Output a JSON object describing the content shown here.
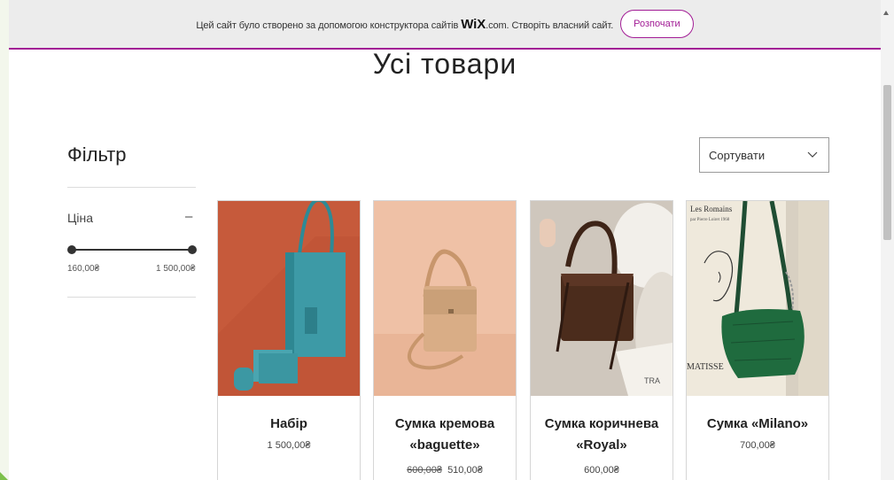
{
  "wix_banner": {
    "text_before": "Цей сайт було створено за допомогою конструктора сайтів ",
    "logo": "WiX",
    "text_after": ".com. Створіть власний сайт.",
    "button_label": "Розпочати"
  },
  "page": {
    "title": "Усі товари"
  },
  "filter": {
    "title": "Фільтр",
    "price_label": "Ціна",
    "toggle_symbol": "–",
    "min_price": "160,00₴",
    "max_price": "1 500,00₴"
  },
  "sort": {
    "label": "Сортувати",
    "icon": "chevron-down-icon"
  },
  "products": [
    {
      "name": "Набір",
      "price": "1 500,00₴"
    },
    {
      "name": "Сумка кремова «baguette»",
      "old_price": "600,00₴",
      "price": "510,00₴"
    },
    {
      "name": "Сумка коричнева «Royal»",
      "price": "600,00₴"
    },
    {
      "name": "Сумка «Milano»",
      "price": "700,00₴"
    }
  ],
  "image_captions": {
    "poster_text": "Les Romains",
    "poster_sub": "par Pierre Loiret 1968",
    "matisse": "MATISSE",
    "newspaper": "TRA"
  },
  "colors": {
    "wix_accent": "#a21c95",
    "banner_bg": "#ececec",
    "frame_bg": "#f3f7ec"
  }
}
